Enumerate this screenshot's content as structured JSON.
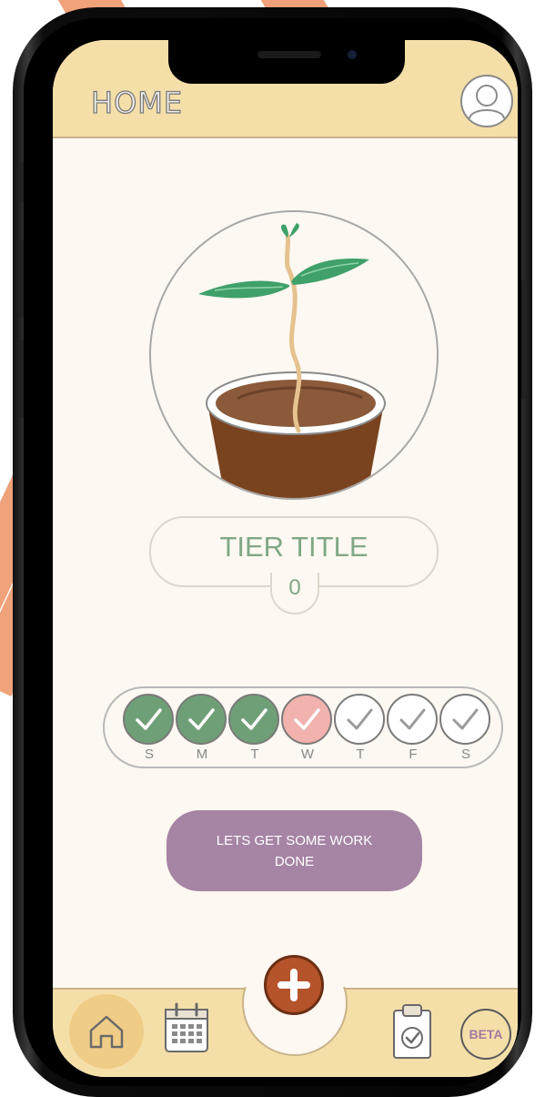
{
  "header": {
    "title": "HOME"
  },
  "plant": {
    "illustration": "seedling-in-pot"
  },
  "tier": {
    "title": "TIER TITLE",
    "count": "0"
  },
  "week": {
    "days": [
      {
        "label": "S",
        "status": "done"
      },
      {
        "label": "M",
        "status": "done"
      },
      {
        "label": "T",
        "status": "done"
      },
      {
        "label": "W",
        "status": "today"
      },
      {
        "label": "T",
        "status": "pending"
      },
      {
        "label": "F",
        "status": "pending"
      },
      {
        "label": "S",
        "status": "pending"
      }
    ]
  },
  "cta": {
    "label": "LETS GET SOME WORK DONE"
  },
  "nav": {
    "items": [
      {
        "name": "home",
        "icon": "home-icon",
        "active": true
      },
      {
        "name": "calendar",
        "icon": "calendar-icon",
        "active": false
      },
      {
        "name": "add",
        "icon": "plus-icon",
        "active": false
      },
      {
        "name": "tasks",
        "icon": "clipboard-check-icon",
        "active": false
      },
      {
        "name": "beta",
        "icon": "beta-badge",
        "active": false
      }
    ],
    "beta_label": "BETA"
  },
  "colors": {
    "header_bg": "#f5dfa9",
    "screen_bg": "#fdf8f1",
    "done": "#6f9f76",
    "today": "#f2b2ad",
    "accent_purple": "#a684a4",
    "fab": "#b5532b",
    "tier_text": "#7fa886"
  }
}
